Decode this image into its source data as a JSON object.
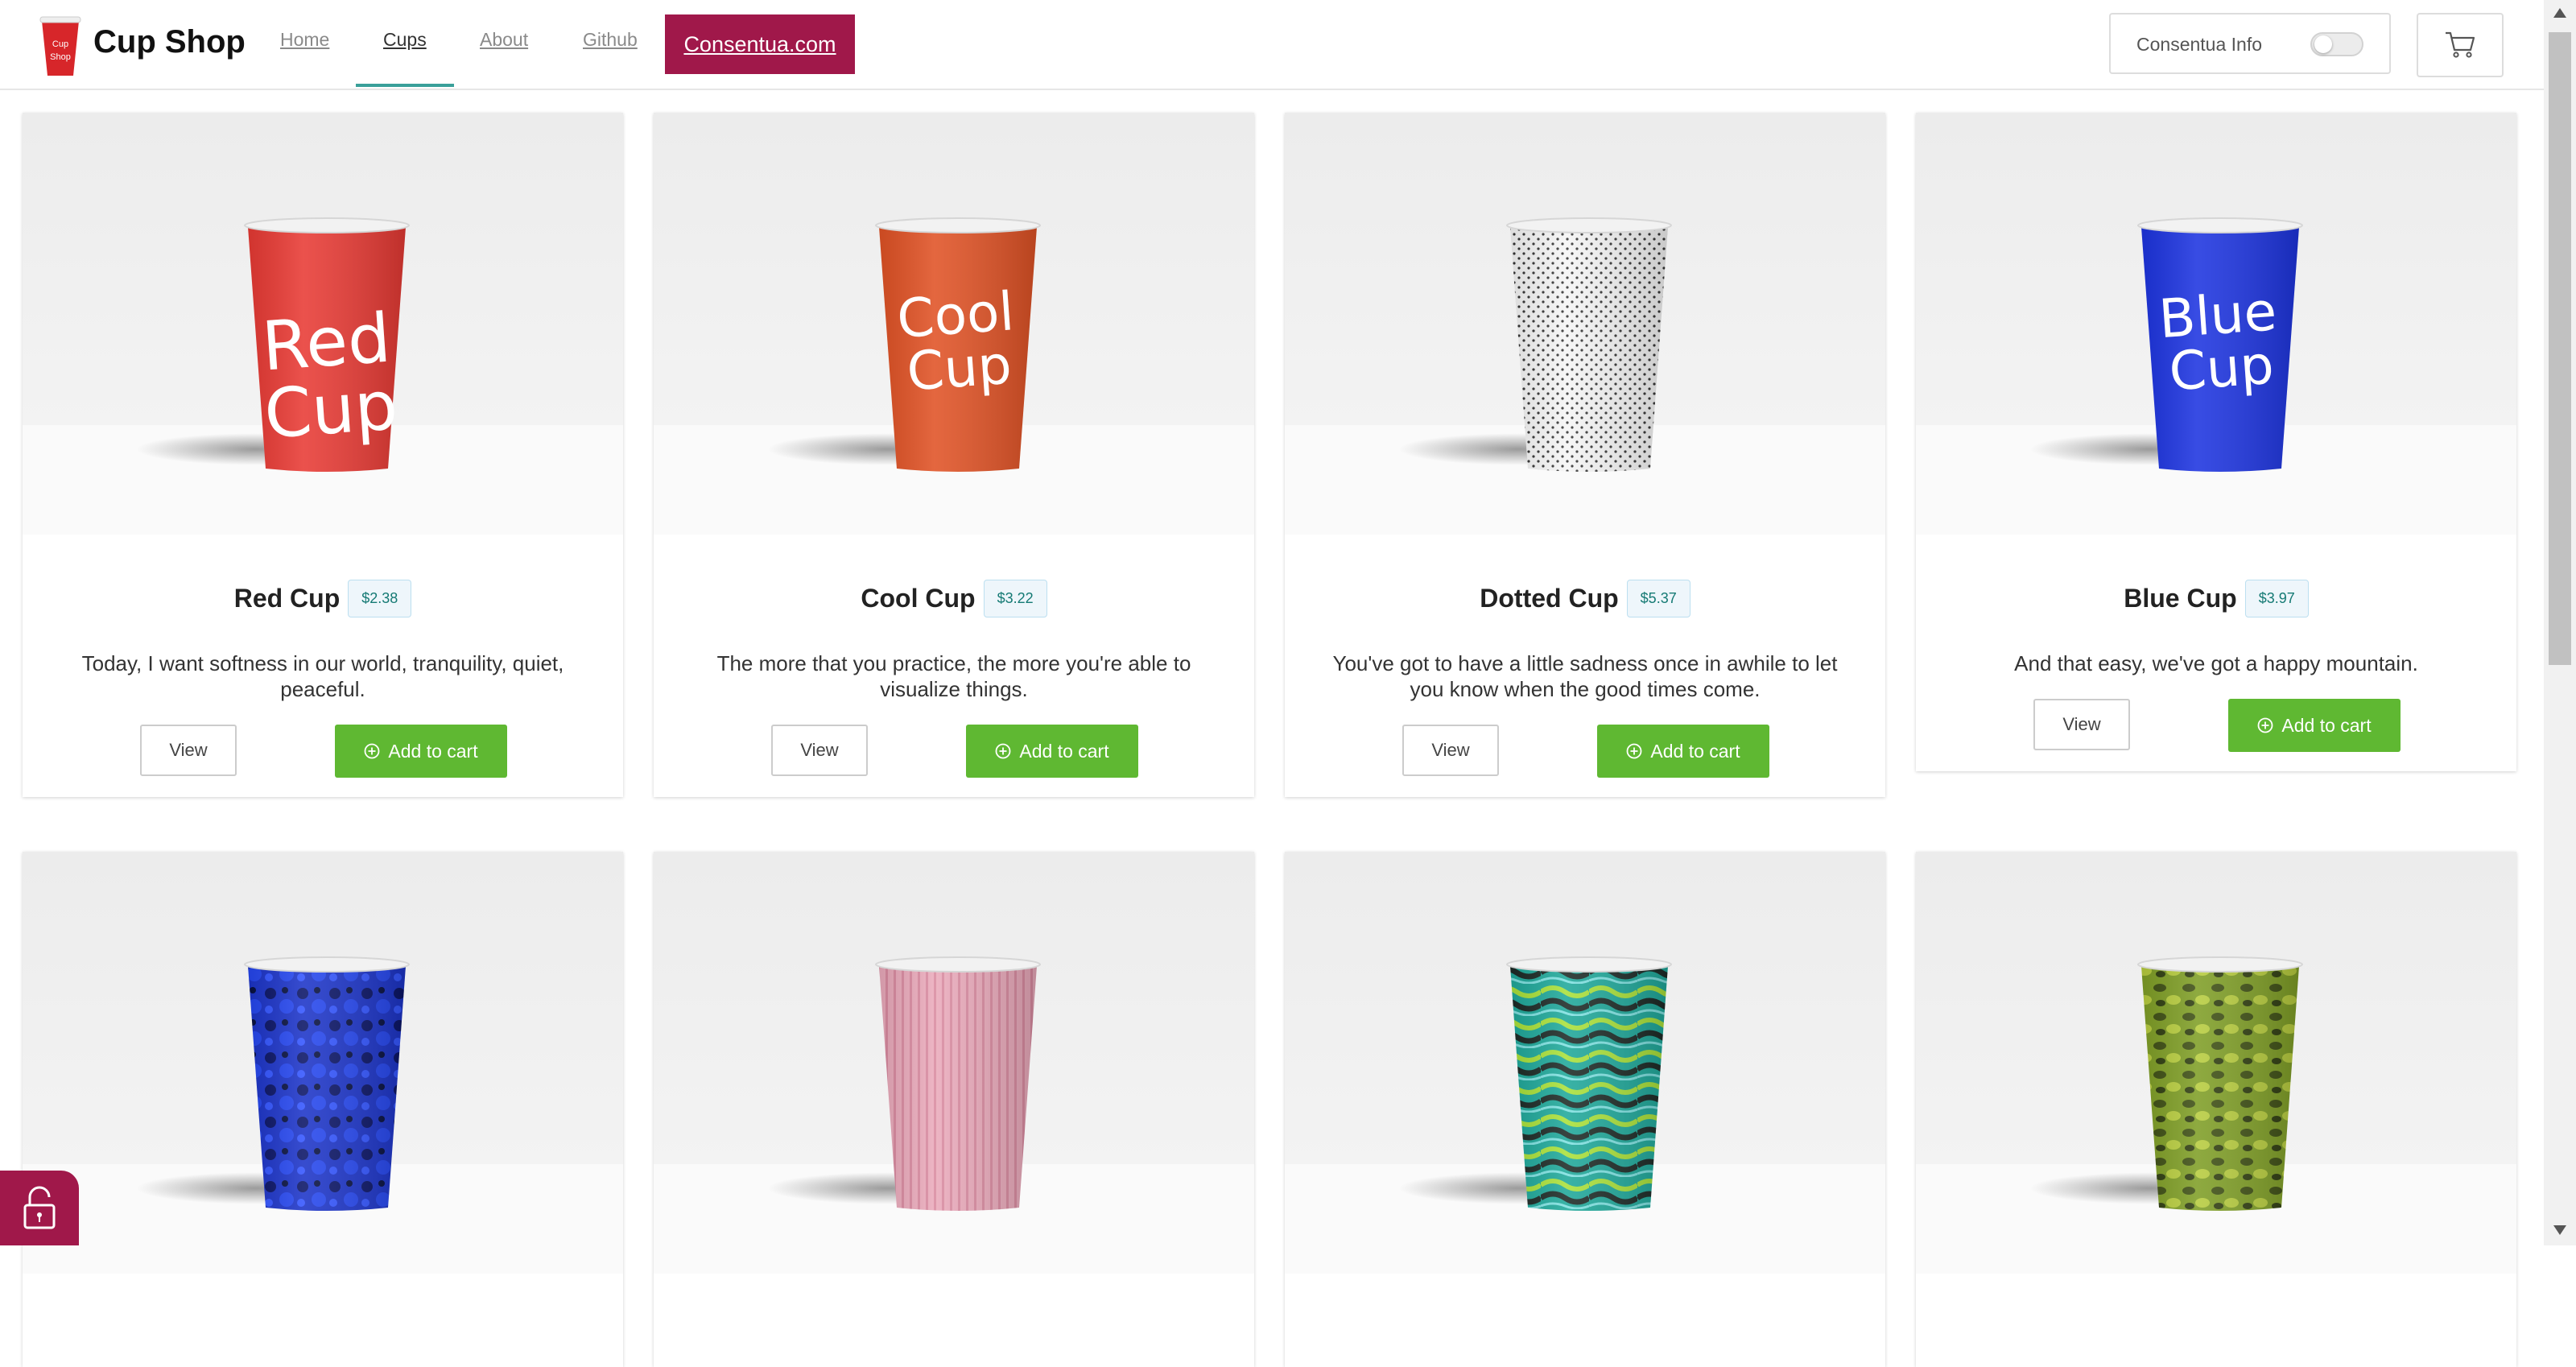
{
  "header": {
    "logo_text_1": "Cup",
    "logo_text_2": "Shop",
    "brand": "Cup Shop",
    "nav": [
      "Home",
      "Cups",
      "About",
      "Github"
    ],
    "consentua_link": "Consentua.com",
    "consentua_info_label": "Consentua Info"
  },
  "products": [
    {
      "name": "Red Cup",
      "price": "$2.38",
      "description": "Today, I want softness in our world, tranquility, quiet, peaceful.",
      "view_label": "View",
      "add_label": "Add to cart",
      "cup_text": [
        "Red",
        "Cup"
      ],
      "color": "#e83a34",
      "pattern": "solid"
    },
    {
      "name": "Cool Cup",
      "price": "$3.22",
      "description": "The more that you practice, the more you're able to visualize things.",
      "view_label": "View",
      "add_label": "Add to cart",
      "cup_text": [
        "Cool",
        "Cup"
      ],
      "color": "#e05225",
      "pattern": "solid"
    },
    {
      "name": "Dotted Cup",
      "price": "$5.37",
      "description": "You've got to have a little sadness once in awhile to let you know when the good times come.",
      "view_label": "View",
      "add_label": "Add to cart",
      "cup_text": [],
      "color": "#f4f4f4",
      "pattern": "dots"
    },
    {
      "name": "Blue Cup",
      "price": "$3.97",
      "description": "And that easy, we've got a happy mountain.",
      "view_label": "View",
      "add_label": "Add to cart",
      "cup_text": [
        "Blue",
        "Cup"
      ],
      "color": "#1d34e0",
      "pattern": "solid"
    },
    {
      "name": "",
      "price": "",
      "description": "",
      "view_label": "",
      "add_label": "",
      "cup_text": [],
      "color": "#1a2fb8",
      "pattern": "marble-blue"
    },
    {
      "name": "",
      "price": "",
      "description": "",
      "view_label": "",
      "add_label": "",
      "cup_text": [],
      "color": "#e8a6b8",
      "pattern": "stripes-pink"
    },
    {
      "name": "",
      "price": "",
      "description": "",
      "view_label": "",
      "add_label": "",
      "cup_text": [],
      "color": "#29b3a6",
      "pattern": "swirl-teal"
    },
    {
      "name": "",
      "price": "",
      "description": "",
      "view_label": "",
      "add_label": "",
      "cup_text": [],
      "color": "#6b8a22",
      "pattern": "camo-green"
    }
  ],
  "icons": {
    "cart": "cart-icon",
    "lock": "unlock-icon",
    "add": "plus-circle-icon"
  }
}
